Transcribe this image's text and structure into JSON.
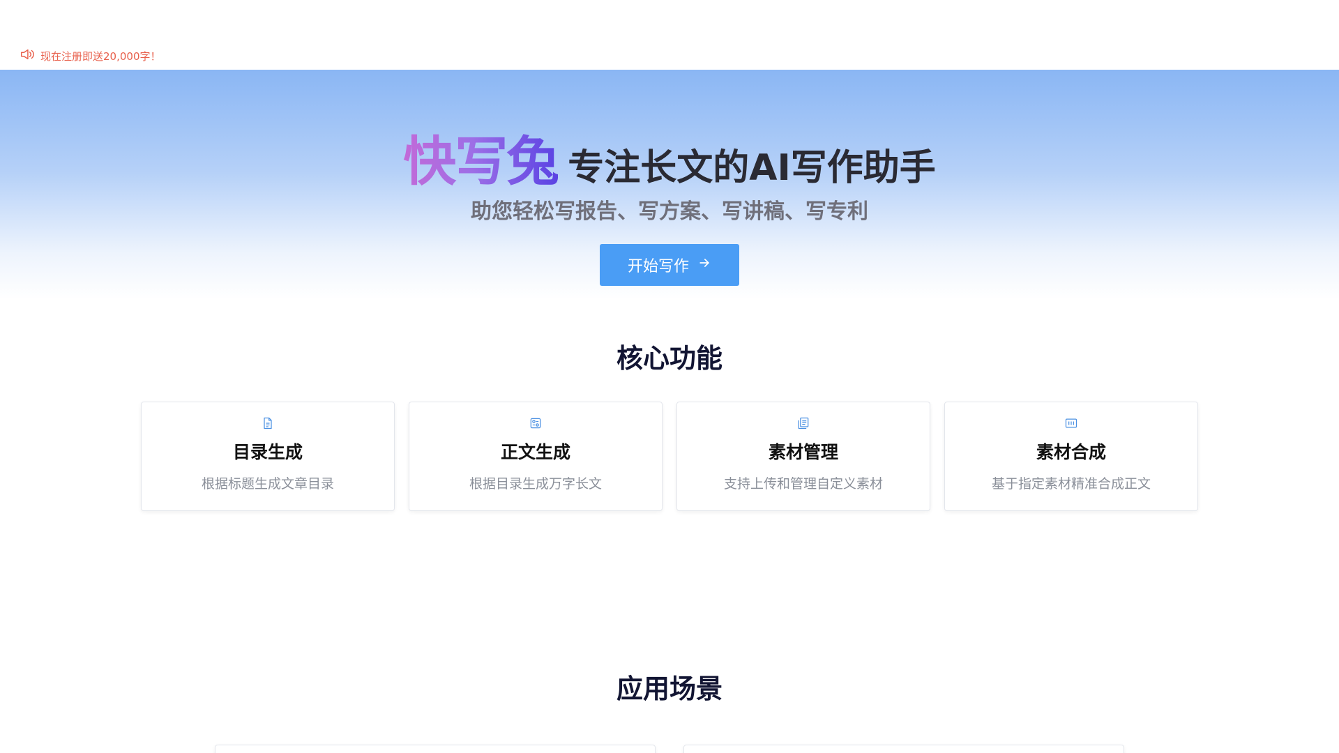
{
  "notice": {
    "icon": "speaker-icon",
    "text": "现在注册即送20,000字！",
    "color": "#e8604c"
  },
  "hero": {
    "brand": "快写兔",
    "slogan": "专注长文的AI写作助手",
    "subtitle": "助您轻松写报告、写方案、写讲稿、写专利",
    "start_button": "开始写作",
    "start_button_icon": "arrow-right-icon",
    "accent": "#4a9df5"
  },
  "core": {
    "title": "核心功能",
    "cards": [
      {
        "icon": "document-icon",
        "title": "目录生成",
        "desc": "根据标题生成文章目录"
      },
      {
        "icon": "settings-doc-icon",
        "title": "正文生成",
        "desc": "根据目录生成万字长文"
      },
      {
        "icon": "files-icon",
        "title": "素材管理",
        "desc": "支持上传和管理自定义素材"
      },
      {
        "icon": "merge-icon",
        "title": "素材合成",
        "desc": "基于指定素材精准合成正文"
      }
    ]
  },
  "scenes": {
    "title": "应用场景"
  }
}
